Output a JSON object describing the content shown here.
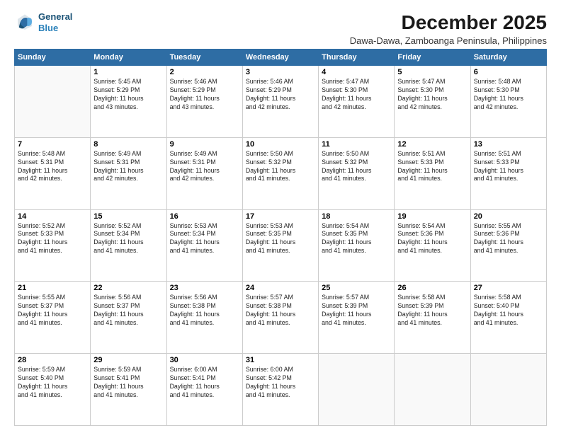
{
  "header": {
    "logo_line1": "General",
    "logo_line2": "Blue",
    "title": "December 2025",
    "subtitle": "Dawa-Dawa, Zamboanga Peninsula, Philippines"
  },
  "weekdays": [
    "Sunday",
    "Monday",
    "Tuesday",
    "Wednesday",
    "Thursday",
    "Friday",
    "Saturday"
  ],
  "weeks": [
    [
      {
        "day": null,
        "info": null
      },
      {
        "day": "1",
        "info": "Sunrise: 5:45 AM\nSunset: 5:29 PM\nDaylight: 11 hours\nand 43 minutes."
      },
      {
        "day": "2",
        "info": "Sunrise: 5:46 AM\nSunset: 5:29 PM\nDaylight: 11 hours\nand 43 minutes."
      },
      {
        "day": "3",
        "info": "Sunrise: 5:46 AM\nSunset: 5:29 PM\nDaylight: 11 hours\nand 42 minutes."
      },
      {
        "day": "4",
        "info": "Sunrise: 5:47 AM\nSunset: 5:30 PM\nDaylight: 11 hours\nand 42 minutes."
      },
      {
        "day": "5",
        "info": "Sunrise: 5:47 AM\nSunset: 5:30 PM\nDaylight: 11 hours\nand 42 minutes."
      },
      {
        "day": "6",
        "info": "Sunrise: 5:48 AM\nSunset: 5:30 PM\nDaylight: 11 hours\nand 42 minutes."
      }
    ],
    [
      {
        "day": "7",
        "info": "Sunrise: 5:48 AM\nSunset: 5:31 PM\nDaylight: 11 hours\nand 42 minutes."
      },
      {
        "day": "8",
        "info": "Sunrise: 5:49 AM\nSunset: 5:31 PM\nDaylight: 11 hours\nand 42 minutes."
      },
      {
        "day": "9",
        "info": "Sunrise: 5:49 AM\nSunset: 5:31 PM\nDaylight: 11 hours\nand 42 minutes."
      },
      {
        "day": "10",
        "info": "Sunrise: 5:50 AM\nSunset: 5:32 PM\nDaylight: 11 hours\nand 41 minutes."
      },
      {
        "day": "11",
        "info": "Sunrise: 5:50 AM\nSunset: 5:32 PM\nDaylight: 11 hours\nand 41 minutes."
      },
      {
        "day": "12",
        "info": "Sunrise: 5:51 AM\nSunset: 5:33 PM\nDaylight: 11 hours\nand 41 minutes."
      },
      {
        "day": "13",
        "info": "Sunrise: 5:51 AM\nSunset: 5:33 PM\nDaylight: 11 hours\nand 41 minutes."
      }
    ],
    [
      {
        "day": "14",
        "info": "Sunrise: 5:52 AM\nSunset: 5:33 PM\nDaylight: 11 hours\nand 41 minutes."
      },
      {
        "day": "15",
        "info": "Sunrise: 5:52 AM\nSunset: 5:34 PM\nDaylight: 11 hours\nand 41 minutes."
      },
      {
        "day": "16",
        "info": "Sunrise: 5:53 AM\nSunset: 5:34 PM\nDaylight: 11 hours\nand 41 minutes."
      },
      {
        "day": "17",
        "info": "Sunrise: 5:53 AM\nSunset: 5:35 PM\nDaylight: 11 hours\nand 41 minutes."
      },
      {
        "day": "18",
        "info": "Sunrise: 5:54 AM\nSunset: 5:35 PM\nDaylight: 11 hours\nand 41 minutes."
      },
      {
        "day": "19",
        "info": "Sunrise: 5:54 AM\nSunset: 5:36 PM\nDaylight: 11 hours\nand 41 minutes."
      },
      {
        "day": "20",
        "info": "Sunrise: 5:55 AM\nSunset: 5:36 PM\nDaylight: 11 hours\nand 41 minutes."
      }
    ],
    [
      {
        "day": "21",
        "info": "Sunrise: 5:55 AM\nSunset: 5:37 PM\nDaylight: 11 hours\nand 41 minutes."
      },
      {
        "day": "22",
        "info": "Sunrise: 5:56 AM\nSunset: 5:37 PM\nDaylight: 11 hours\nand 41 minutes."
      },
      {
        "day": "23",
        "info": "Sunrise: 5:56 AM\nSunset: 5:38 PM\nDaylight: 11 hours\nand 41 minutes."
      },
      {
        "day": "24",
        "info": "Sunrise: 5:57 AM\nSunset: 5:38 PM\nDaylight: 11 hours\nand 41 minutes."
      },
      {
        "day": "25",
        "info": "Sunrise: 5:57 AM\nSunset: 5:39 PM\nDaylight: 11 hours\nand 41 minutes."
      },
      {
        "day": "26",
        "info": "Sunrise: 5:58 AM\nSunset: 5:39 PM\nDaylight: 11 hours\nand 41 minutes."
      },
      {
        "day": "27",
        "info": "Sunrise: 5:58 AM\nSunset: 5:40 PM\nDaylight: 11 hours\nand 41 minutes."
      }
    ],
    [
      {
        "day": "28",
        "info": "Sunrise: 5:59 AM\nSunset: 5:40 PM\nDaylight: 11 hours\nand 41 minutes."
      },
      {
        "day": "29",
        "info": "Sunrise: 5:59 AM\nSunset: 5:41 PM\nDaylight: 11 hours\nand 41 minutes."
      },
      {
        "day": "30",
        "info": "Sunrise: 6:00 AM\nSunset: 5:41 PM\nDaylight: 11 hours\nand 41 minutes."
      },
      {
        "day": "31",
        "info": "Sunrise: 6:00 AM\nSunset: 5:42 PM\nDaylight: 11 hours\nand 41 minutes."
      },
      {
        "day": null,
        "info": null
      },
      {
        "day": null,
        "info": null
      },
      {
        "day": null,
        "info": null
      }
    ]
  ]
}
